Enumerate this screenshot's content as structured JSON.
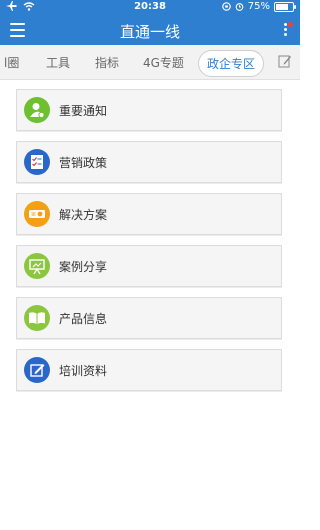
{
  "status": {
    "time": "20:38",
    "battery_pct": "75%",
    "battery_level": 0.75
  },
  "header": {
    "title": "直通一线"
  },
  "tabs": [
    {
      "label": "l圈"
    },
    {
      "label": "工具"
    },
    {
      "label": "指标"
    },
    {
      "label": "4G专题"
    },
    {
      "label": "政企专区",
      "active": true
    }
  ],
  "items": [
    {
      "label": "重要通知",
      "icon": "person-icon",
      "color": "#6ec12e"
    },
    {
      "label": "营销政策",
      "icon": "checklist-icon",
      "color": "#2b67c8"
    },
    {
      "label": "解决方案",
      "icon": "projector-icon",
      "color": "#f3a012"
    },
    {
      "label": "案例分享",
      "icon": "presentation-icon",
      "color": "#8cc63f"
    },
    {
      "label": "产品信息",
      "icon": "book-icon",
      "color": "#8cc63f"
    },
    {
      "label": "培训资料",
      "icon": "edit-icon",
      "color": "#2b67c8"
    }
  ]
}
